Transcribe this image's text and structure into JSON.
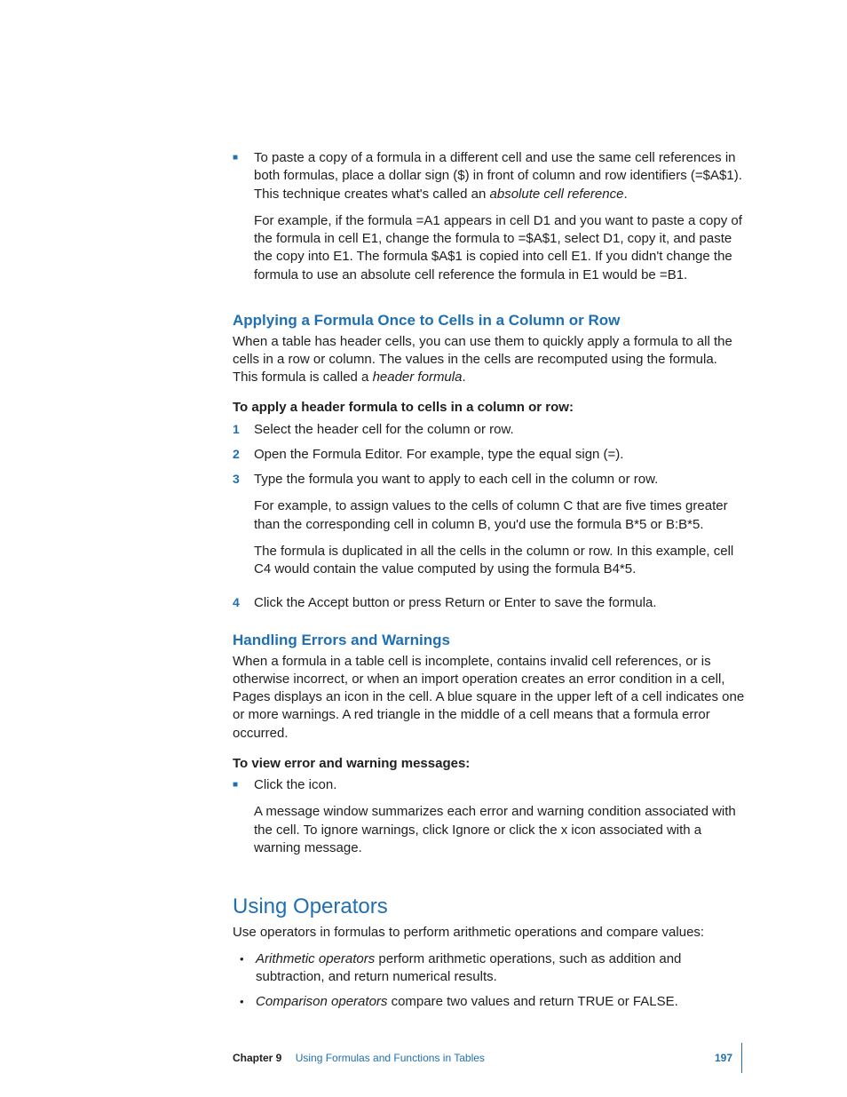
{
  "top_bullet": {
    "p1_a": "To paste a copy of a formula in a different cell and use the same cell references in both formulas, place a dollar sign ($) in front of column and row identifiers (=$A$1). This technique creates what's called an ",
    "p1_em": "absolute cell reference",
    "p1_b": ".",
    "p2": "For example, if the formula =A1 appears in cell D1 and you want to paste a copy of the formula in cell E1, change the formula to =$A$1, select D1, copy it, and paste the copy into E1. The formula $A$1 is copied into cell E1. If you didn't change the formula to use an absolute cell reference the formula in E1 would be =B1."
  },
  "sec1": {
    "title": "Applying a Formula Once to Cells in a Column or Row",
    "intro_a": "When a table has header cells, you can use them to quickly apply a formula to all the cells in a row or column. The values in the cells are recomputed using the formula. This formula is called a ",
    "intro_em": "header formula",
    "intro_b": ".",
    "task_title": "To apply a header formula to cells in a column or row:",
    "steps": {
      "s1": "Select the header cell for the column or row.",
      "s2": "Open the Formula Editor. For example, type the equal sign (=).",
      "s3": "Type the formula you want to apply to each cell in the column or row.",
      "s3_ex": "For example, to assign values to the cells of column C that are five times greater than the corresponding cell in column B, you'd use the formula B*5 or B:B*5.",
      "s3_dup": "The formula is duplicated in all the cells in the column or row. In this example, cell C4 would contain the value computed by using the formula B4*5.",
      "s4": "Click the Accept button or press Return or Enter to save the formula."
    }
  },
  "sec2": {
    "title": "Handling Errors and Warnings",
    "intro": "When a formula in a table cell is incomplete, contains invalid cell references, or is otherwise incorrect, or when an import operation creates an error condition in a cell, Pages displays an icon in the cell. A blue square in the upper left of a cell indicates one or more warnings. A red triangle in the middle of a cell means that a formula error occurred.",
    "task_title": "To view error and warning messages:",
    "b1": "Click the icon.",
    "b1_extra": "A message window summarizes each error and warning condition associated with the cell. To ignore warnings, click Ignore or click the x icon associated with a warning message."
  },
  "sec3": {
    "title": "Using Operators",
    "intro": "Use operators in formulas to perform arithmetic operations and compare values:",
    "b1_em": "Arithmetic operators",
    "b1_rest": " perform arithmetic operations, such as addition and subtraction, and return numerical results.",
    "b2_em": "Comparison operators",
    "b2_rest": " compare two values and return TRUE or FALSE."
  },
  "footer": {
    "chapter": "Chapter 9",
    "title": "Using Formulas and Functions in Tables",
    "page": "197"
  }
}
